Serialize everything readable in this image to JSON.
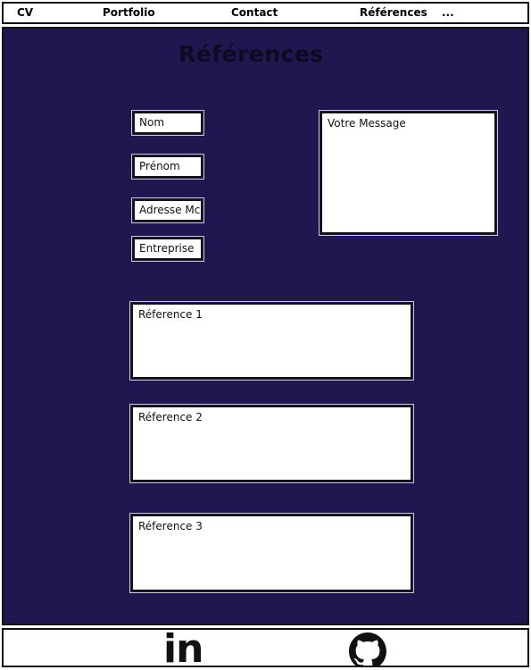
{
  "nav": {
    "items": [
      "CV",
      "Portfolio",
      "Contact",
      "Références",
      "..."
    ]
  },
  "main": {
    "title": "Références",
    "form": {
      "nom": "Nom",
      "prenom": "Prénom",
      "adresse": "Adresse Mc",
      "entreprise": "Entreprise",
      "message": "Votre Message"
    },
    "references": [
      "Réference 1",
      "Réference 2",
      "Réference 3"
    ]
  },
  "footer": {
    "icons": [
      "linkedin-icon",
      "github-icon"
    ],
    "linkedin_text": "in"
  },
  "colors": {
    "background": "#221651",
    "title": "#0e0a22",
    "field": "#ffffff"
  }
}
